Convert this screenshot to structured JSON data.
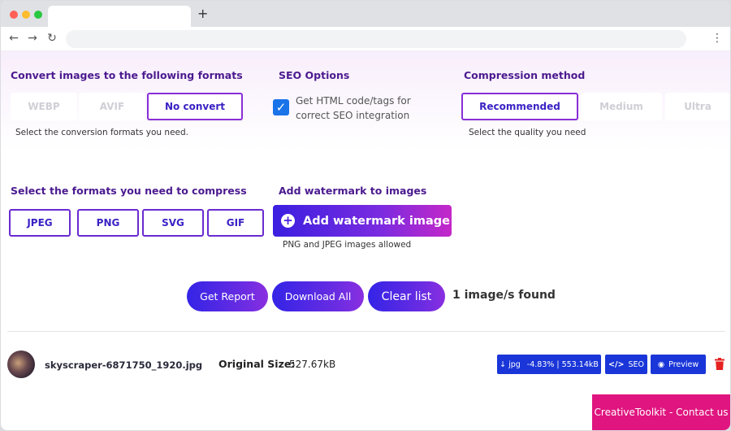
{
  "browser": {
    "new_tab_glyph": "+",
    "back_glyph": "←",
    "forward_glyph": "→",
    "reload_glyph": "↻",
    "menu_glyph": "⋮",
    "dot_colors": [
      "#ff5f57",
      "#febc2e",
      "#28c840"
    ]
  },
  "convert": {
    "heading": "Convert images to the following formats",
    "options": [
      "WEBP",
      "AVIF",
      "No convert"
    ],
    "selected": "No convert",
    "hint": "Select the conversion formats you need."
  },
  "seo": {
    "heading": "SEO Options",
    "checkbox_label": "Get HTML code/tags for correct SEO integration",
    "checked": true,
    "check_glyph": "✓"
  },
  "compression": {
    "heading": "Compression method",
    "options": [
      "Recommended",
      "Medium",
      "Ultra"
    ],
    "selected": "Recommended",
    "hint": "Select the quality you need"
  },
  "compress_formats": {
    "heading": "Select the formats you need to compress",
    "options": [
      "JPEG",
      "PNG",
      "SVG",
      "GIF"
    ]
  },
  "watermark": {
    "heading": "Add watermark to images",
    "button_icon": "+",
    "button_label": "Add watermark image",
    "hint": "PNG and JPEG images allowed"
  },
  "actions": {
    "get_report": "Get Report",
    "download_all": "Download All",
    "clear_list": "Clear list",
    "found_text": "1 image/s found"
  },
  "file": {
    "name": "skyscraper-6871750_1920.jpg",
    "original_size_label": "Original Size:",
    "original_size_value": "527.67kB",
    "download_icon": "↓",
    "download_format": "jpg",
    "download_stats": "-4.83% | 553.14kB",
    "seo_icon": "</>",
    "seo_label": "SEO",
    "preview_icon": "◉",
    "preview_label": "Preview"
  },
  "footer": {
    "contact": "CreativeToolkit - Contact us"
  },
  "colors": {
    "heading": "#4b1a8f",
    "accent_blue": "#1a36d8",
    "accent_purple": "#8a2fd6",
    "contact_pink": "#e0157f",
    "delete_red": "#e52222"
  }
}
